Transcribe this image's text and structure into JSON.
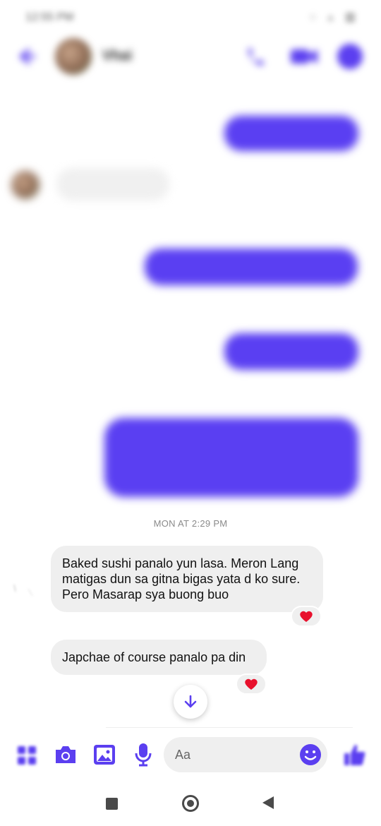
{
  "status_bar": {
    "time": "12:55 PM",
    "icons": "◌ ▵ ▥"
  },
  "header": {
    "back_icon": "back-arrow-icon",
    "contact_name": "Vhai",
    "accent": "#5b3ff0"
  },
  "blurred_thread": {
    "timestamps": [
      "",
      "",
      "",
      ""
    ],
    "outgoing": [
      "",
      "",
      "",
      ""
    ],
    "incoming": [
      ""
    ]
  },
  "thread": {
    "timestamp": "MON AT 2:29 PM",
    "messages": [
      {
        "text": "Baked sushi panalo yun lasa. Meron Lang matigas dun sa gitna bigas yata d ko sure. Pero Masarap sya buong buo",
        "reaction": "heart"
      },
      {
        "text": "Japchae of course panalo pa din",
        "reaction": "heart"
      }
    ],
    "reaction_color": "#e8112d"
  },
  "composer": {
    "placeholder": "Aa",
    "icons": [
      "menu-icon",
      "camera-icon",
      "gallery-icon",
      "mic-icon",
      "emoji-icon",
      "thumbs-up-icon"
    ]
  },
  "nav_bar": {
    "icons": [
      "recents-icon",
      "home-icon",
      "back-icon"
    ]
  }
}
